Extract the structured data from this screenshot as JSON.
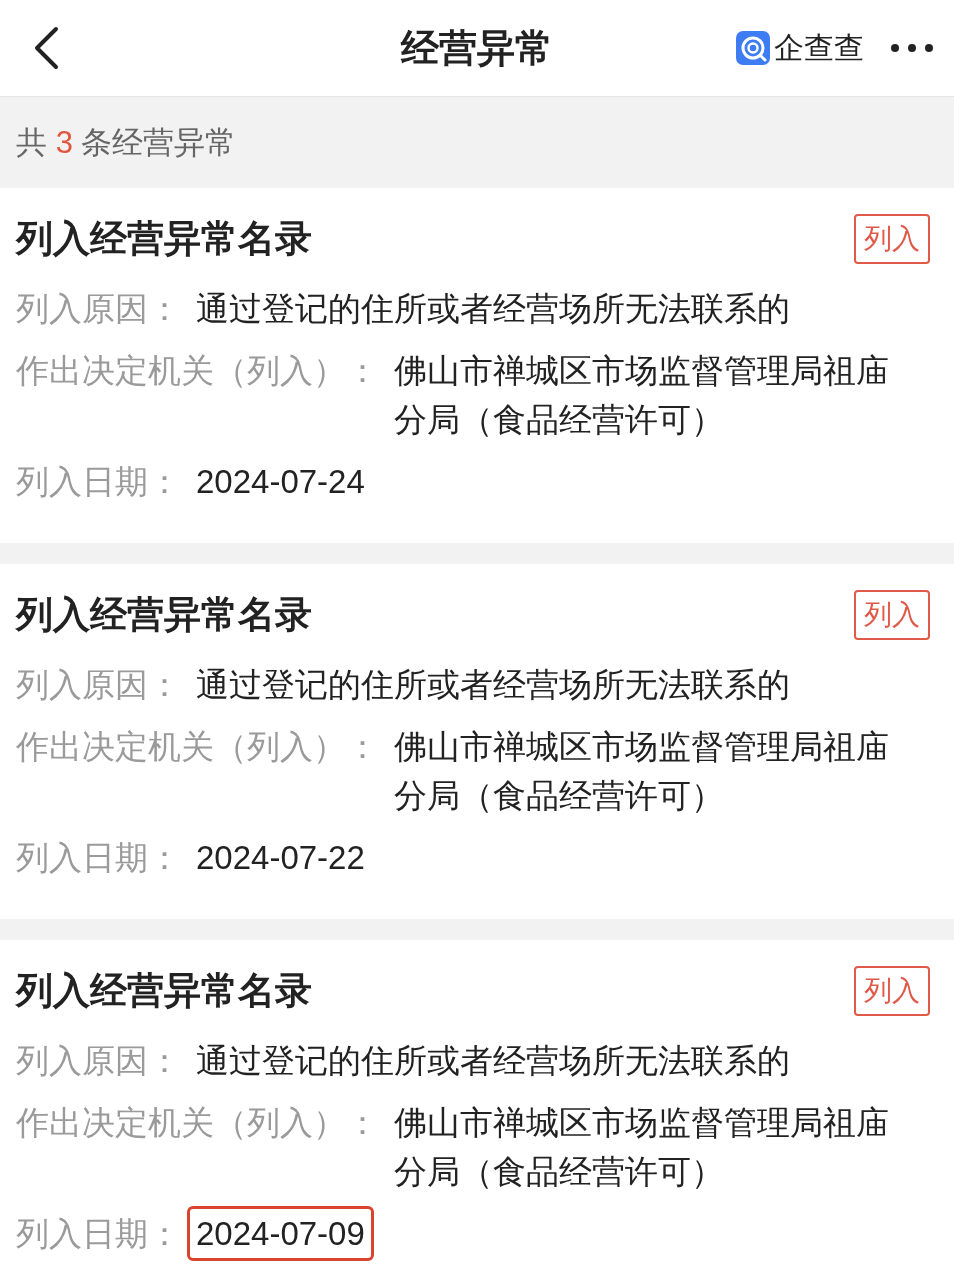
{
  "header": {
    "title": "经营异常",
    "brand": "企查查"
  },
  "summary": {
    "prefix": "共",
    "count": "3",
    "suffix": "条经营异常"
  },
  "records": [
    {
      "title": "列入经营异常名录",
      "tag": "列入",
      "fields": [
        {
          "label": "列入原因：",
          "value": "通过登记的住所或者经营场所无法联系的",
          "highlighted": false
        },
        {
          "label": "作出决定机关（列入）：",
          "value": "佛山市禅城区市场监督管理局祖庙分局（食品经营许可）",
          "highlighted": false
        },
        {
          "label": "列入日期：",
          "value": "2024-07-24",
          "highlighted": false
        }
      ]
    },
    {
      "title": "列入经营异常名录",
      "tag": "列入",
      "fields": [
        {
          "label": "列入原因：",
          "value": "通过登记的住所或者经营场所无法联系的",
          "highlighted": false
        },
        {
          "label": "作出决定机关（列入）：",
          "value": "佛山市禅城区市场监督管理局祖庙分局（食品经营许可）",
          "highlighted": false
        },
        {
          "label": "列入日期：",
          "value": "2024-07-22",
          "highlighted": false
        }
      ]
    },
    {
      "title": "列入经营异常名录",
      "tag": "列入",
      "fields": [
        {
          "label": "列入原因：",
          "value": "通过登记的住所或者经营场所无法联系的",
          "highlighted": false
        },
        {
          "label": "作出决定机关（列入）：",
          "value": "佛山市禅城区市场监督管理局祖庙分局（食品经营许可）",
          "highlighted": false
        },
        {
          "label": "列入日期：",
          "value": "2024-07-09",
          "highlighted": true
        }
      ]
    }
  ]
}
